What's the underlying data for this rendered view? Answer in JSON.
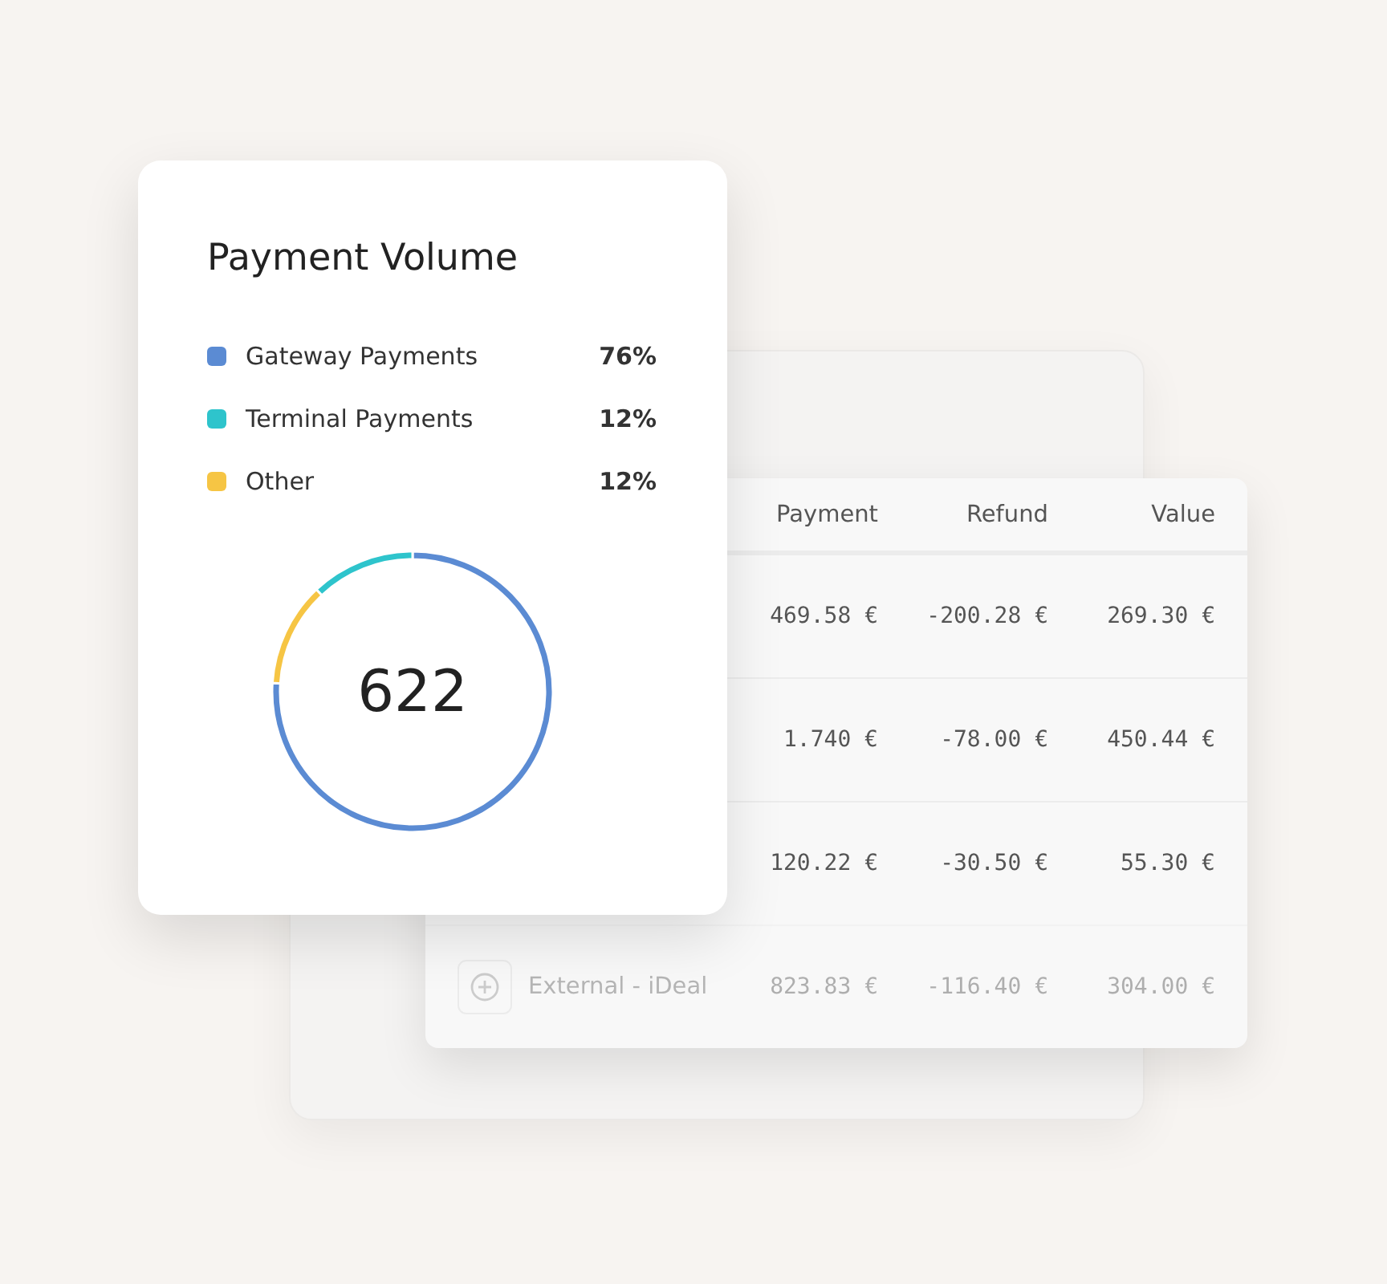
{
  "payment_card": {
    "title": "Payment Volume",
    "legend": [
      {
        "label": "Gateway Payments",
        "percent": "76%",
        "color": "#5b8bd3"
      },
      {
        "label": "Terminal Payments",
        "percent": "12%",
        "color": "#2ec4cc"
      },
      {
        "label": "Other",
        "percent": "12%",
        "color": "#f6c544"
      }
    ],
    "total": "622",
    "chart_data": {
      "type": "donut",
      "values": [
        76,
        12,
        12
      ],
      "colors": [
        "#5b8bd3",
        "#f6c544",
        "#2ec4cc"
      ]
    }
  },
  "table": {
    "columns": [
      "Payment",
      "Refund",
      "Value"
    ],
    "rows": [
      {
        "cells": [
          "469.58 €",
          "-200.28 €",
          "269.30 €"
        ],
        "dimmed": false
      },
      {
        "cells": [
          "1.740 €",
          "-78.00 €",
          "450.44 €"
        ],
        "dimmed": false
      },
      {
        "cells": [
          "120.22 €",
          "-30.50 €",
          "55.30 €"
        ],
        "dimmed": false
      },
      {
        "name": "External - iDeal",
        "cells": [
          "823.83 €",
          "-116.40 €",
          "304.00 €"
        ],
        "dimmed": true
      }
    ]
  }
}
